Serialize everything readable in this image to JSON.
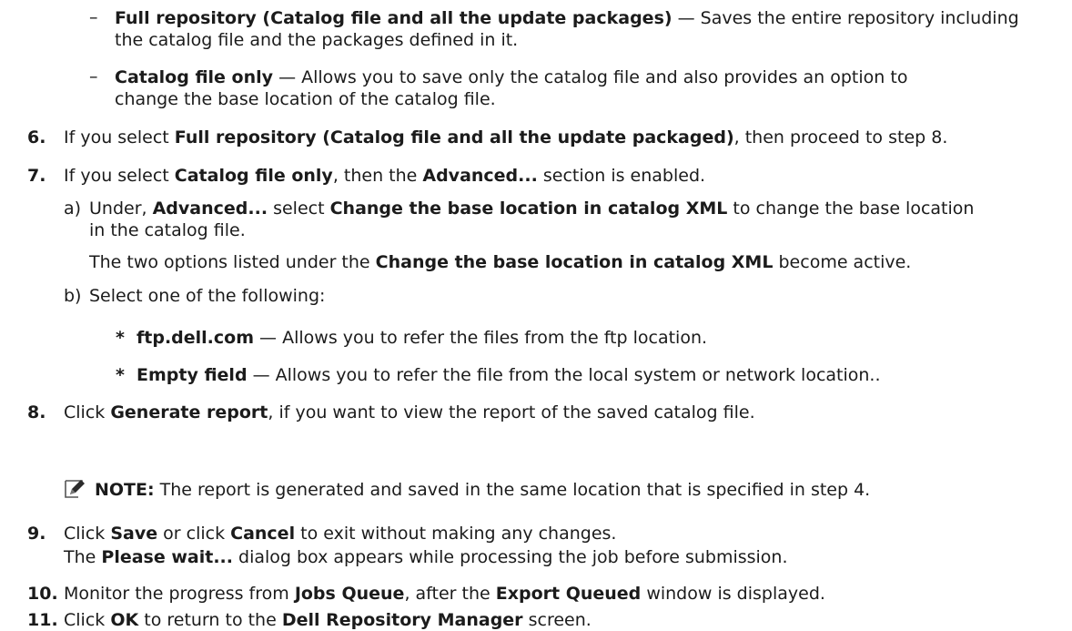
{
  "sub": {
    "full": {
      "b": "Full repository (Catalog file and all the update packages)",
      "t": " — Saves the entire repository including",
      "l2": "the catalog file and the packages defined in it."
    },
    "cat": {
      "b": "Catalog file only",
      "t": " — Allows you to save only the catalog file and also provides an option to",
      "l2": "change the base location of the catalog file."
    }
  },
  "s6": {
    "num": "6.",
    "t1": "If you select ",
    "b1": "Full repository (Catalog file and all the update packaged)",
    "t2": ", then proceed to step 8."
  },
  "s7": {
    "num": "7.",
    "t1": "If you select ",
    "b1": "Catalog file only",
    "t2": ", then the ",
    "b2": "Advanced...",
    "t3": " section is enabled."
  },
  "s7a": {
    "label": "a)",
    "t1": "Under, ",
    "b1": "Advanced...",
    "t2": " select ",
    "b2": "Change the base location in catalog XML",
    "t3": " to change the base location",
    "l2": "in the catalog file.",
    "p1": "The two options listed under the ",
    "pb": "Change the base location in catalog XML",
    "p2": " become active."
  },
  "s7b": {
    "label": "b)",
    "t": "Select one of the following:"
  },
  "ftp": {
    "b": "ftp.dell.com",
    "t": " — Allows you to refer the files from the ftp location."
  },
  "empty": {
    "b": "Empty field",
    "t": " — Allows you to refer the file from the local system or network location.."
  },
  "s8": {
    "num": "8.",
    "t1": "Click ",
    "b1": "Generate report",
    "t2": ", if you want to view the report of the saved catalog file."
  },
  "note": {
    "b": "NOTE:",
    "t": " The report is generated and saved in the same location that is specified in step 4."
  },
  "s9": {
    "num": "9.",
    "t1": "Click ",
    "b1": "Save",
    "t2": " or click ",
    "b2": "Cancel",
    "t3": " to exit without making any changes.",
    "p1": "The ",
    "pb": "Please wait...",
    "p2": " dialog box appears while processing the job before submission."
  },
  "s10": {
    "num": "10.",
    "t1": "Monitor the progress from ",
    "b1": "Jobs Queue",
    "t2": ", after the ",
    "b2": "Export Queued",
    "t3": " window is displayed."
  },
  "s11": {
    "num": "11.",
    "t1": "Click ",
    "b1": "OK",
    "t2": " to return to the ",
    "b2": "Dell Repository Manager",
    "t3": " screen."
  },
  "bullets": {
    "dash": "–",
    "star": "*"
  }
}
